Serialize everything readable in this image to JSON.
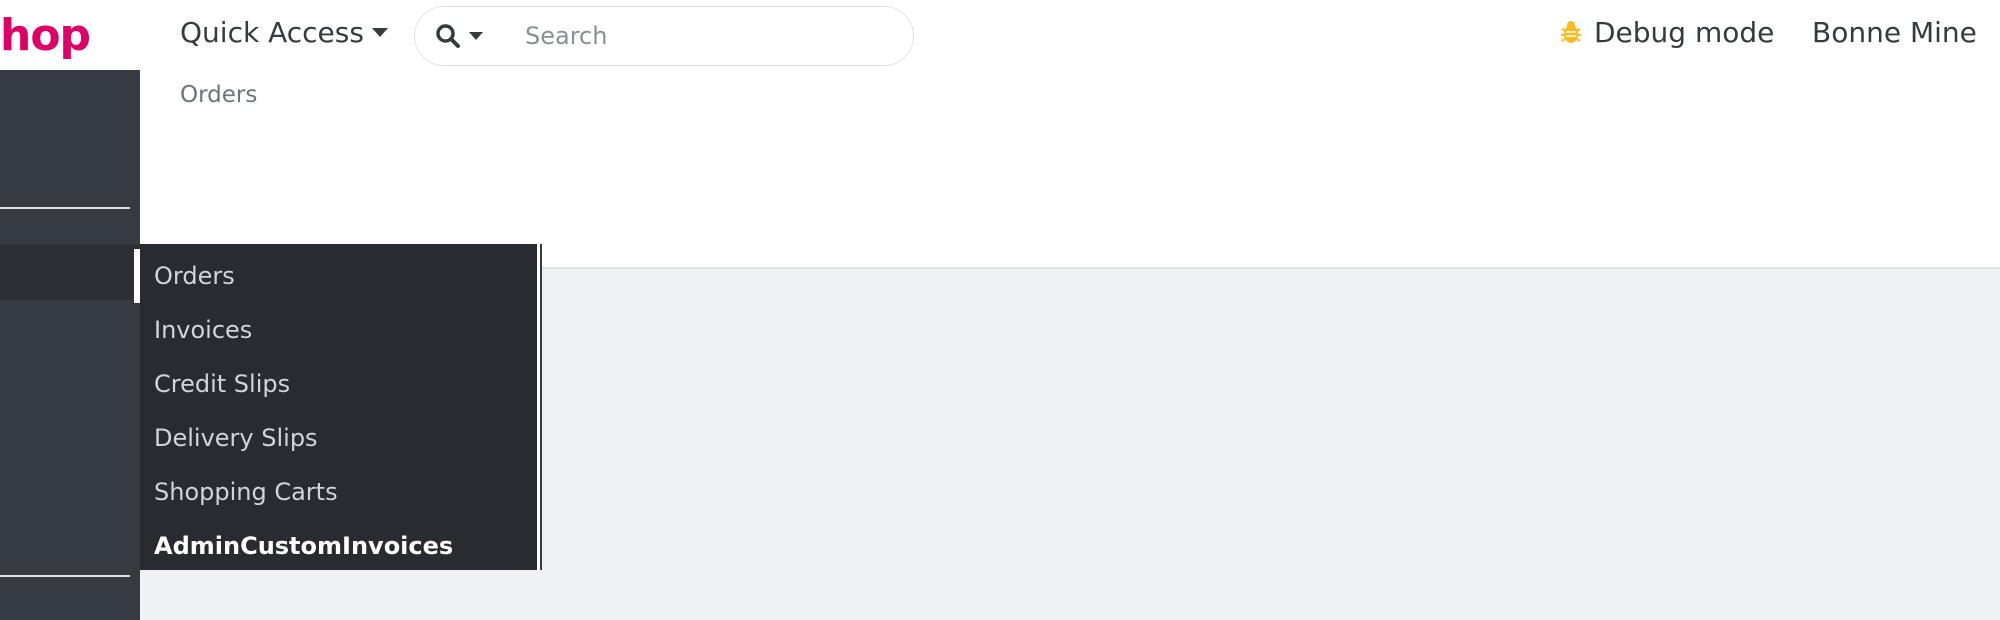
{
  "header": {
    "logo_text": "hop",
    "quick_access_label": "Quick Access",
    "search": {
      "placeholder": "Search"
    },
    "debug_label": "Debug mode",
    "shop_name": "Bonne Mine"
  },
  "breadcrumb": {
    "current": "Orders"
  },
  "submenu": {
    "items": [
      {
        "label": "Orders"
      },
      {
        "label": "Invoices"
      },
      {
        "label": "Credit Slips"
      },
      {
        "label": "Delivery Slips"
      },
      {
        "label": "Shopping Carts"
      },
      {
        "label": "AdminCustomInvoices"
      }
    ]
  },
  "colors": {
    "brand": "#df0067",
    "sidebar_bg": "#363a41",
    "submenu_bg": "#282b30",
    "debug_icon": "#fbbb22",
    "content_bg": "#eff1f2"
  },
  "icons": {
    "search": "search-icon",
    "debug": "bug-icon"
  }
}
